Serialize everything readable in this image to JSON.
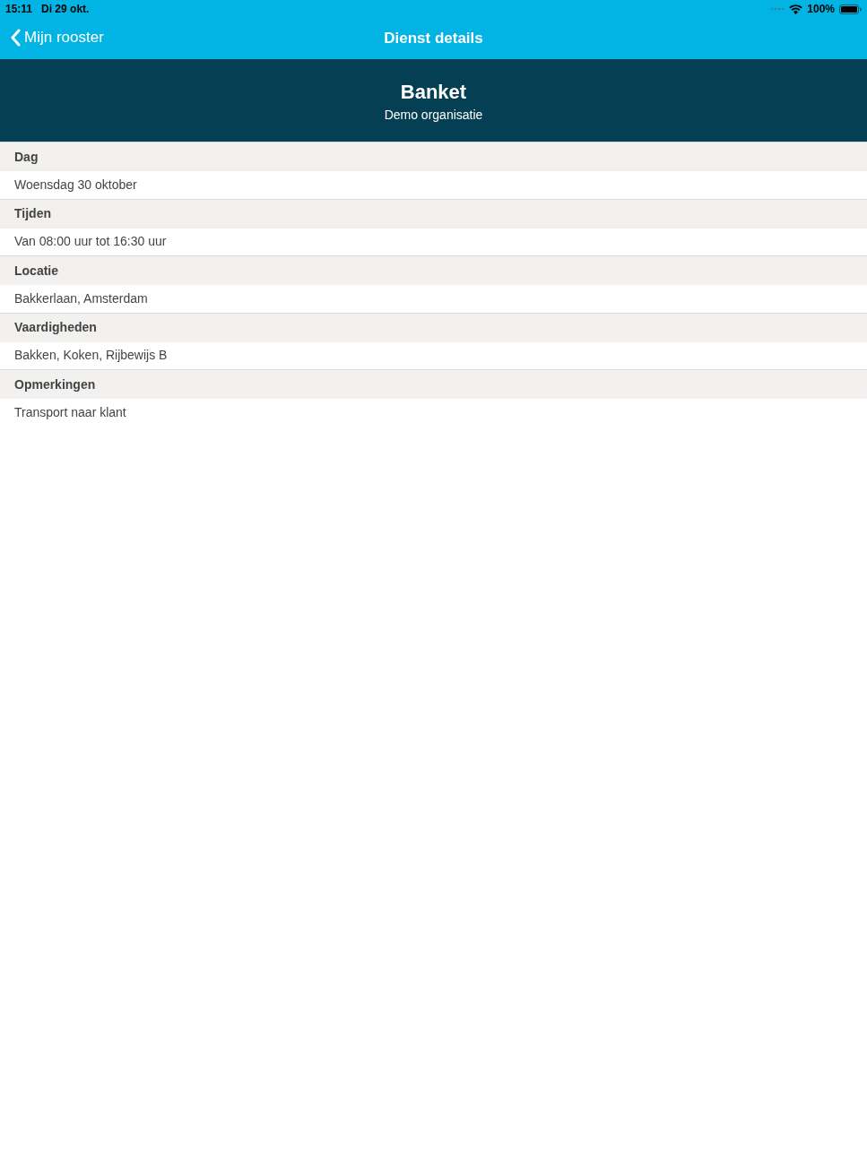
{
  "status_bar": {
    "time": "15:11",
    "date": "Di 29 okt.",
    "battery": "100%"
  },
  "nav_bar": {
    "back_label": "Mijn rooster",
    "title": "Dienst details"
  },
  "header": {
    "title": "Banket",
    "subtitle": "Demo organisatie"
  },
  "sections": [
    {
      "label": "Dag",
      "value": "Woensdag 30 oktober"
    },
    {
      "label": "Tijden",
      "value": "Van 08:00 uur tot 16:30 uur"
    },
    {
      "label": "Locatie",
      "value": "Bakkerlaan, Amsterdam"
    },
    {
      "label": "Vaardigheden",
      "value": "Bakken, Koken, Rijbewijs B"
    },
    {
      "label": "Opmerkingen",
      "value": "Transport naar klant"
    }
  ]
}
